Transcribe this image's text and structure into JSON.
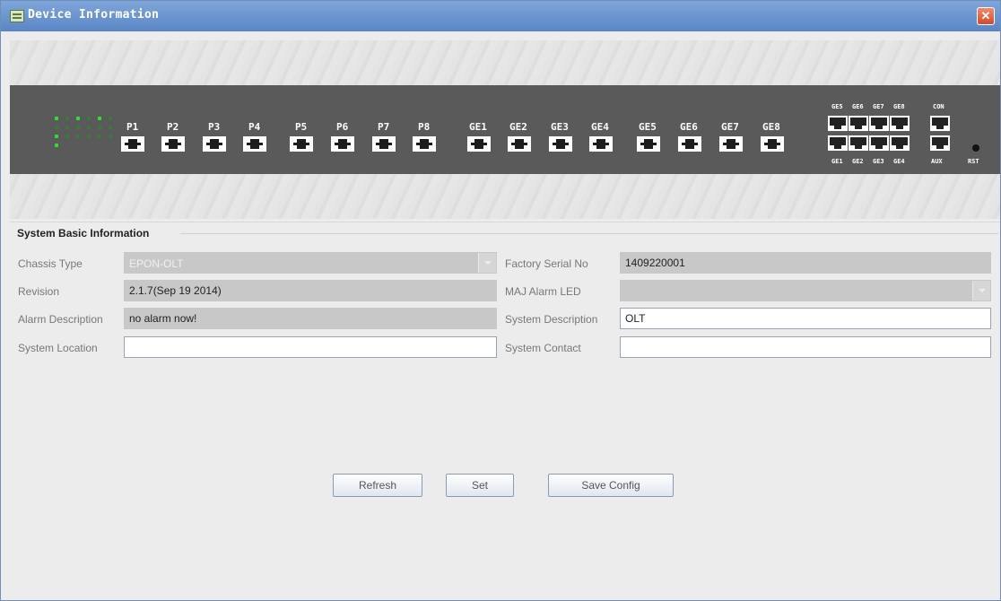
{
  "window": {
    "title": "Device Information",
    "close_label": "✕"
  },
  "panel": {
    "pon_ports": [
      "P1",
      "P2",
      "P3",
      "P4",
      "P5",
      "P6",
      "P7",
      "P8"
    ],
    "ge_ports": [
      "GE1",
      "GE2",
      "GE3",
      "GE4",
      "GE5",
      "GE6",
      "GE7",
      "GE8"
    ],
    "rj_top_labels": [
      "GE5",
      "GE6",
      "GE7",
      "GE8"
    ],
    "rj_bottom_labels": [
      "GE1",
      "GE2",
      "GE3",
      "GE4"
    ],
    "console_label": "CON",
    "aux_label": "AUX",
    "rst_label": "RST"
  },
  "section": {
    "title": "System Basic Information"
  },
  "fields": {
    "chassis_type": {
      "label": "Chassis Type",
      "value": "EPON-OLT"
    },
    "factory_serial": {
      "label": "Factory Serial No",
      "value": "1409220001"
    },
    "revision": {
      "label": "Revision",
      "value": "2.1.7(Sep 19 2014)"
    },
    "maj_alarm_led": {
      "label": "MAJ Alarm LED",
      "value": ""
    },
    "alarm_description": {
      "label": "Alarm Description",
      "value": "no alarm now!"
    },
    "system_description": {
      "label": "System Description",
      "value": "OLT"
    },
    "system_location": {
      "label": "System Location",
      "value": ""
    },
    "system_contact": {
      "label": "System Contact",
      "value": ""
    }
  },
  "buttons": {
    "refresh": "Refresh",
    "set": "Set",
    "save_config": "Save Config"
  },
  "colors": {
    "titlebar": "#6a95cf",
    "panel": "#5a5a5a",
    "led": "#2fe02f"
  }
}
